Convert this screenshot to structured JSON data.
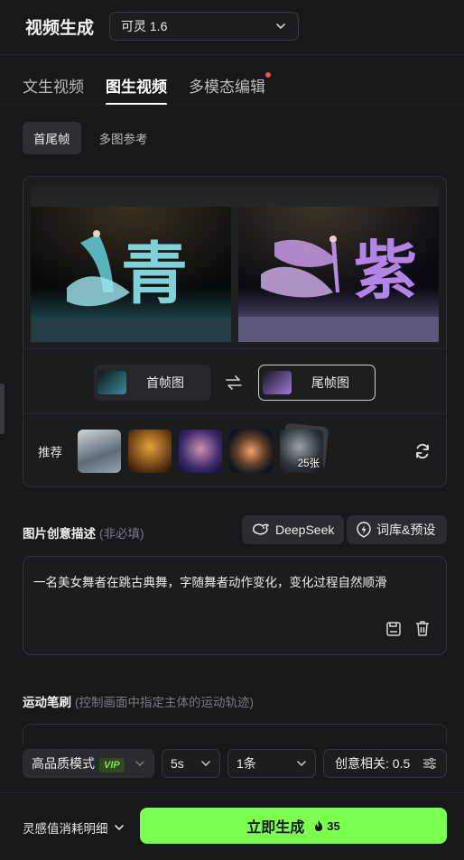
{
  "header": {
    "title": "视频生成",
    "model_select": "可灵 1.6"
  },
  "tabs": [
    {
      "label": "文生视频"
    },
    {
      "label": "图生视频"
    },
    {
      "label": "多模态编辑"
    }
  ],
  "subtabs": [
    {
      "label": "首尾帧"
    },
    {
      "label": "多图参考"
    }
  ],
  "frames": {
    "first_label": "首帧图",
    "last_label": "尾帧图",
    "first_char": "青",
    "last_char": "紫"
  },
  "recommend": {
    "label": "推荐",
    "count_badge": "25张",
    "icons": [
      "refresh-icon"
    ]
  },
  "prompt": {
    "title": "图片创意描述",
    "hint": "(非必填)",
    "deepseek_label": "DeepSeek",
    "library_label": "词库&预设",
    "text": "一名美女舞者在跳古典舞，字随舞者动作变化，变化过程自然顺滑"
  },
  "motion": {
    "title": "运动笔刷",
    "hint": "(控制画面中指定主体的运动轨迹)"
  },
  "options": {
    "quality_label": "高品质模式",
    "vip_badge": "VIP",
    "duration": "5s",
    "count": "1条",
    "creativity": "创意相关: 0.5"
  },
  "footer": {
    "credit_label": "灵感值消耗明细",
    "generate_label": "立即生成",
    "cost": "35"
  },
  "colors": {
    "accent": "#7dff4f",
    "background": "#17181a",
    "notification_dot": "#ff4a4a"
  }
}
